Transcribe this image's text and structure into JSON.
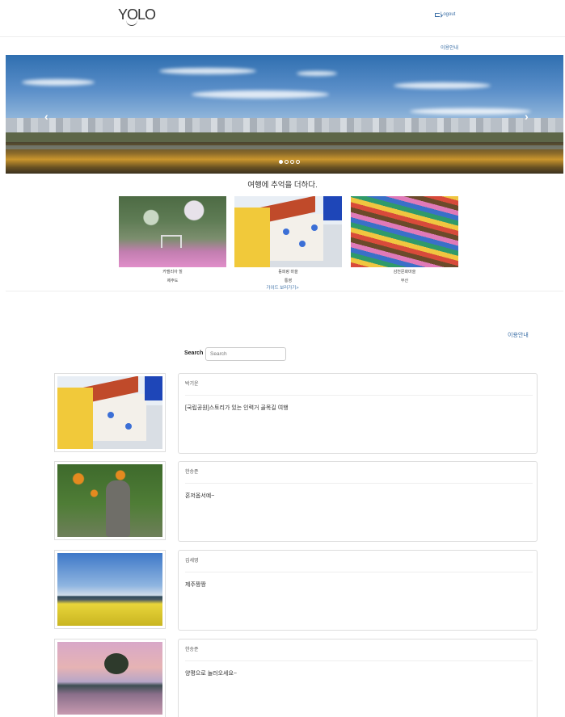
{
  "header": {
    "logo": "YOLO",
    "logout": "Logout"
  },
  "nav": {
    "guide_top": "이용안내",
    "guide_mid": "이용안내"
  },
  "carousel": {
    "prev_icon": "‹",
    "next_icon": "›",
    "slide_count": 4,
    "active_slide": 1
  },
  "tagline": "여행에 추억을 더하다.",
  "featured": [
    {
      "name": "카멜리아 힐",
      "region": "제주도"
    },
    {
      "name": "동피랑 마을",
      "region": "통영"
    },
    {
      "name": "감천문화마을",
      "region": "부산"
    }
  ],
  "guide_more": "가이드 보러가기>",
  "search": {
    "label": "Search",
    "placeholder": "Search"
  },
  "posts": [
    {
      "author": "박기운",
      "title": "[국립공원]스토리가 있는 인력거 골목길 여행"
    },
    {
      "author": "한승준",
      "title": "혼저옵서예~"
    },
    {
      "author": "김세영",
      "title": "제주짱짱"
    },
    {
      "author": "한승준",
      "title": "양평으로 놀러오세요~"
    }
  ],
  "colors": {
    "link": "#3a6ea5",
    "border": "#dddddd"
  }
}
